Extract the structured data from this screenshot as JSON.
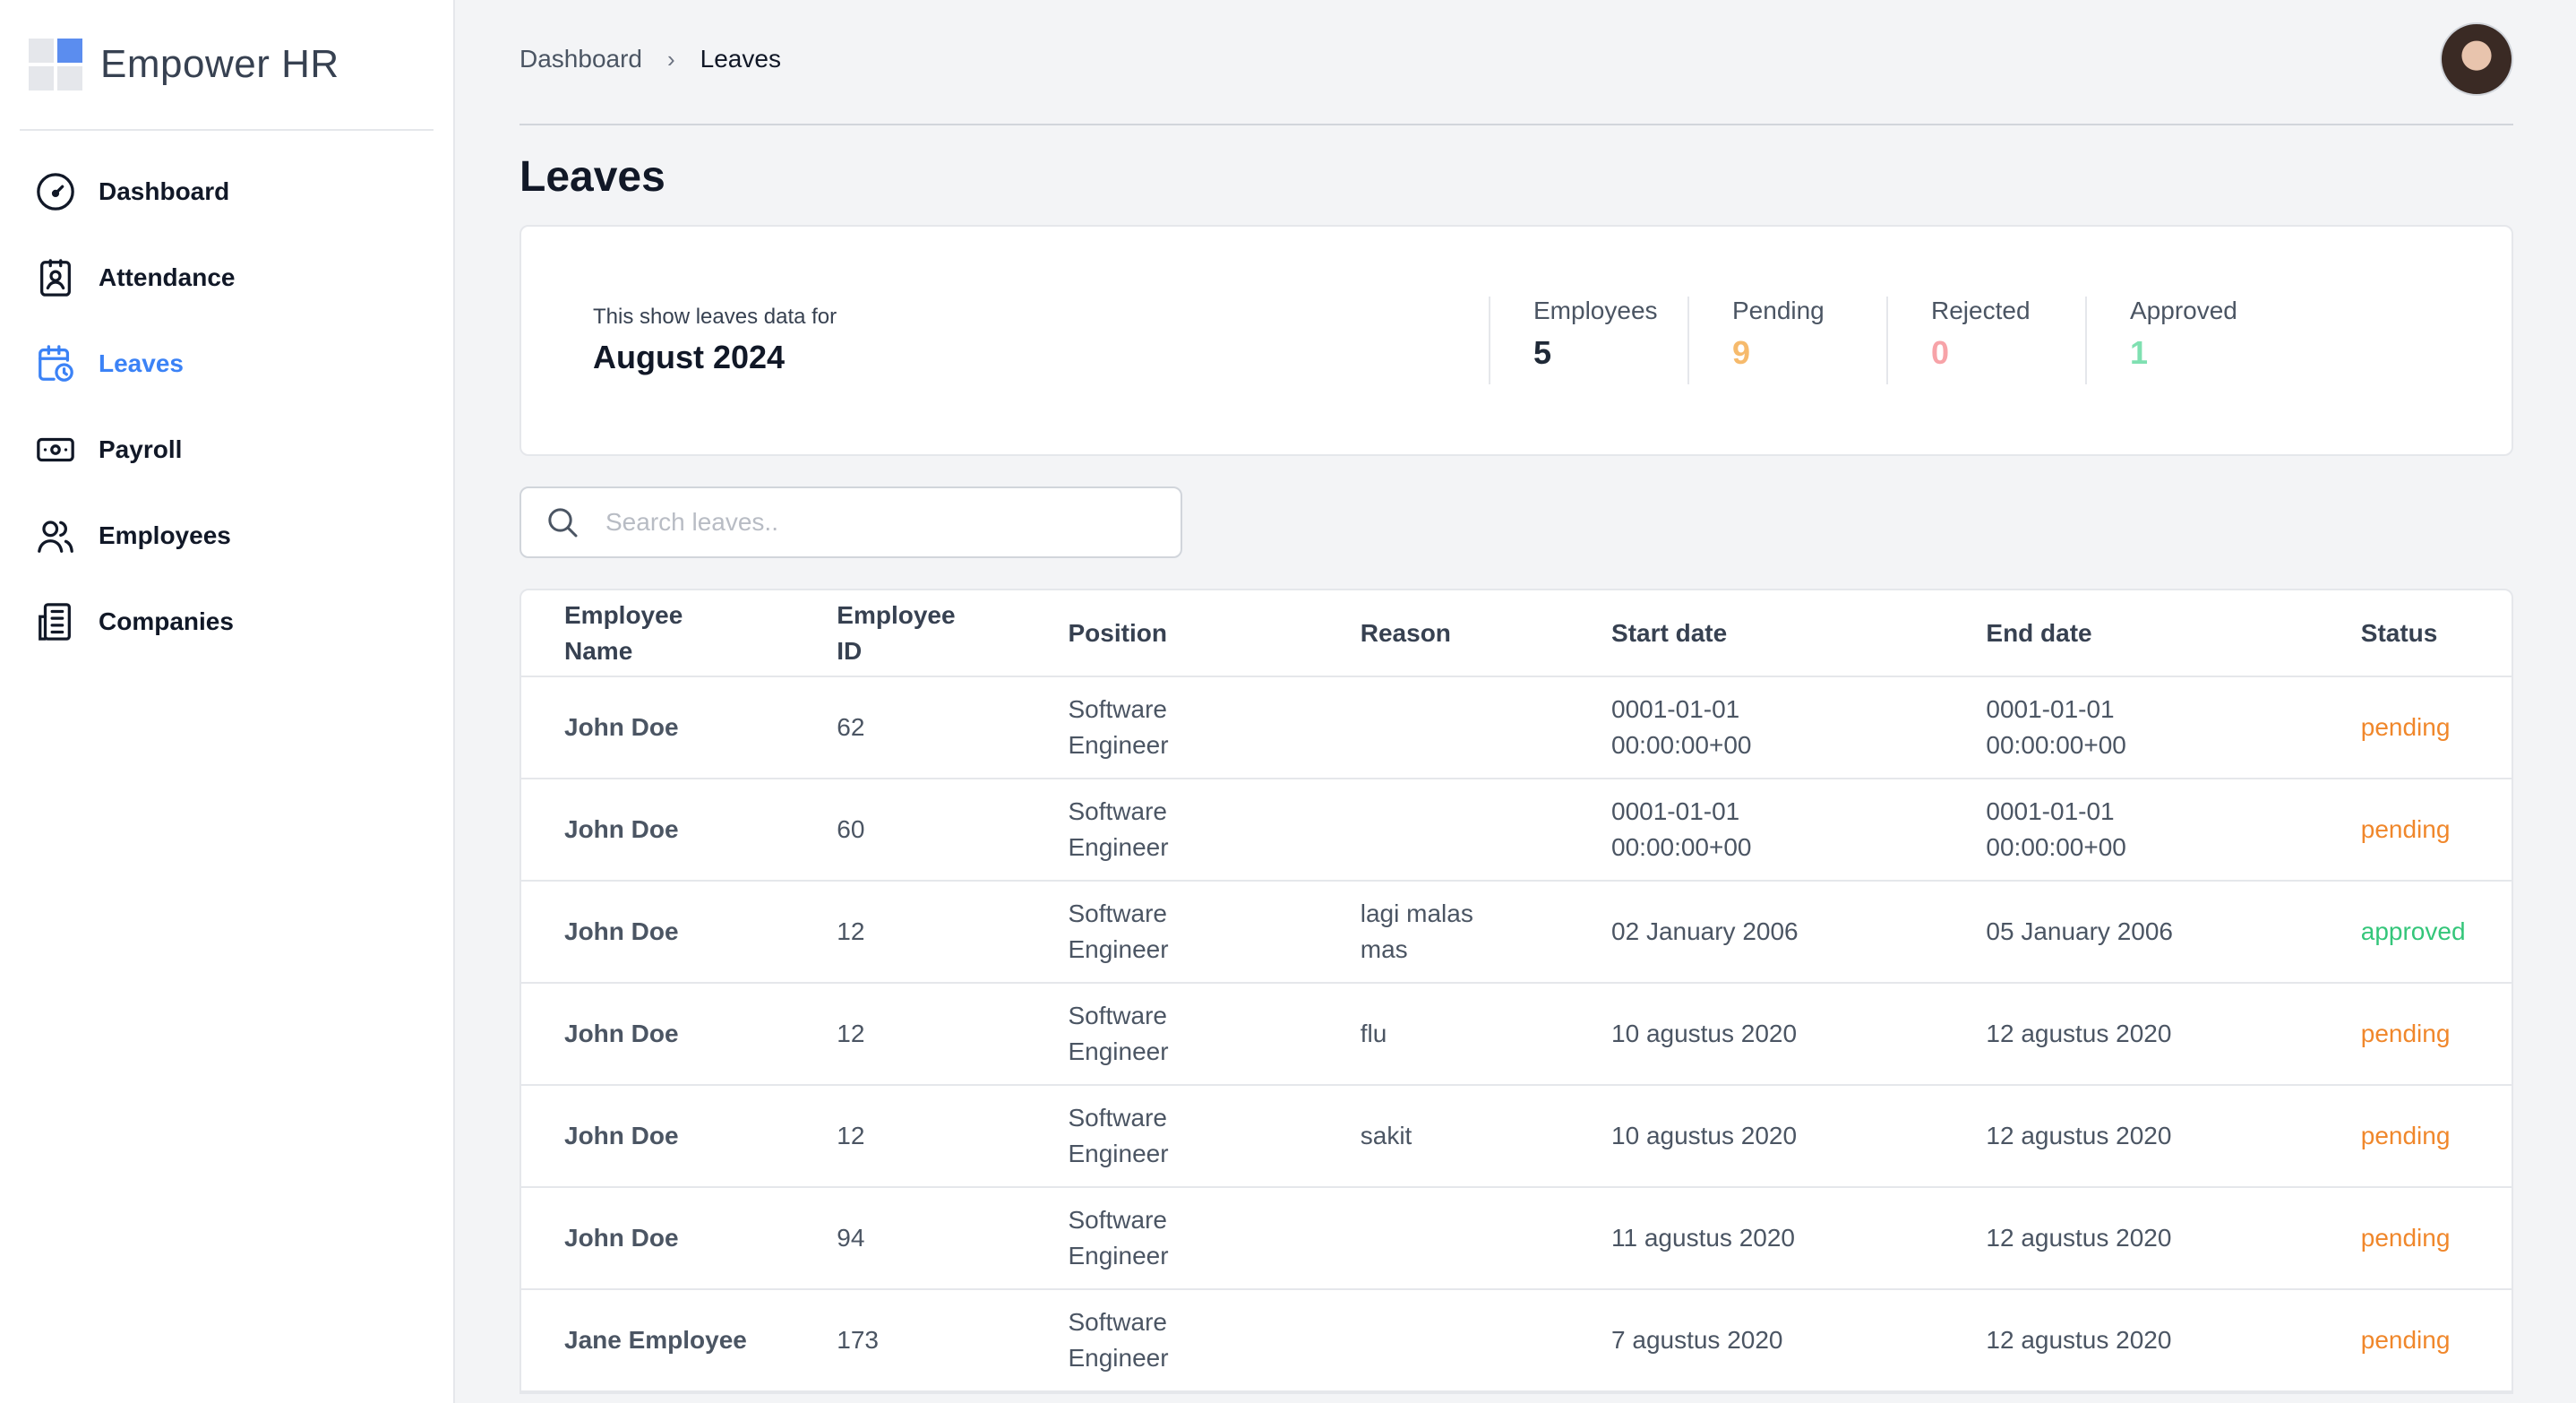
{
  "brand": {
    "name": "Empower HR"
  },
  "sidebar": {
    "items": [
      {
        "label": "Dashboard",
        "icon": "gauge-icon",
        "active": false
      },
      {
        "label": "Attendance",
        "icon": "id-badge-icon",
        "active": false
      },
      {
        "label": "Leaves",
        "icon": "calendar-clock-icon",
        "active": true
      },
      {
        "label": "Payroll",
        "icon": "banknote-icon",
        "active": false
      },
      {
        "label": "Employees",
        "icon": "users-icon",
        "active": false
      },
      {
        "label": "Companies",
        "icon": "building-icon",
        "active": false
      }
    ]
  },
  "breadcrumb": {
    "parent": "Dashboard",
    "separator": "›",
    "current": "Leaves"
  },
  "page": {
    "title": "Leaves"
  },
  "summary": {
    "subtitle": "This show leaves data for",
    "period": "August 2024",
    "stats": [
      {
        "label": "Employees",
        "value": "5",
        "color": "#1f2937"
      },
      {
        "label": "Pending",
        "value": "9",
        "color": "#f6ba6c"
      },
      {
        "label": "Rejected",
        "value": "0",
        "color": "#f7a3a8"
      },
      {
        "label": "Approved",
        "value": "1",
        "color": "#7fe0b1"
      }
    ]
  },
  "search": {
    "placeholder": "Search leaves.."
  },
  "table": {
    "headers": [
      "Employee Name",
      "Employee ID",
      "Position",
      "Reason",
      "Start date",
      "End date",
      "Status"
    ],
    "rows": [
      [
        "John Doe",
        "62",
        "Software Engineer",
        "",
        "0001-01-01 00:00:00+00",
        "0001-01-01 00:00:00+00",
        "pending"
      ],
      [
        "John Doe",
        "60",
        "Software Engineer",
        "",
        "0001-01-01 00:00:00+00",
        "0001-01-01 00:00:00+00",
        "pending"
      ],
      [
        "John Doe",
        "12",
        "Software Engineer",
        "lagi malas mas",
        "02 January 2006",
        "05 January 2006",
        "approved"
      ],
      [
        "John Doe",
        "12",
        "Software Engineer",
        "flu",
        "10 agustus 2020",
        "12 agustus 2020",
        "pending"
      ],
      [
        "John Doe",
        "12",
        "Software Engineer",
        "sakit",
        "10 agustus 2020",
        "12 agustus 2020",
        "pending"
      ],
      [
        "John Doe",
        "94",
        "Software Engineer",
        "",
        "11 agustus 2020",
        "12 agustus 2020",
        "pending"
      ],
      [
        "Jane Employee",
        "173",
        "Software Engineer",
        "",
        "7 agustus 2020",
        "12 agustus 2020",
        "pending"
      ]
    ]
  }
}
